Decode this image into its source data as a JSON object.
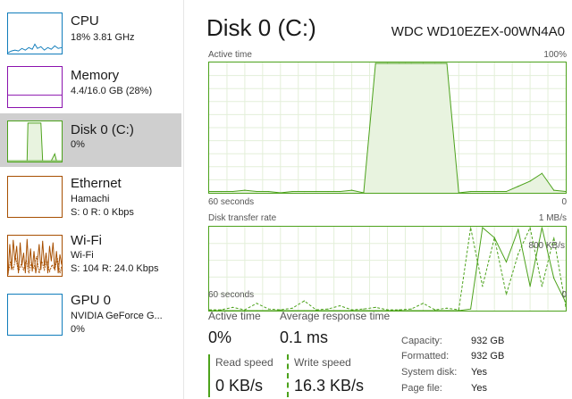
{
  "colors": {
    "cpu": "#117dbb",
    "memory": "#8b12ae",
    "disk": "#4ca21b",
    "ethernet": "#a74f01",
    "wifi": "#a74f01",
    "gpu": "#117dbb",
    "selected_bg": "#cfcfcf"
  },
  "sidebar": {
    "items": [
      {
        "name": "CPU",
        "line1": "18% 3.81 GHz",
        "line2": ""
      },
      {
        "name": "Memory",
        "line1": "4.4/16.0 GB (28%)",
        "line2": ""
      },
      {
        "name": "Disk 0 (C:)",
        "line1": "0%",
        "line2": "",
        "selected": true
      },
      {
        "name": "Ethernet",
        "line1": "Hamachi",
        "line2": "S: 0 R: 0 Kbps"
      },
      {
        "name": "Wi-Fi",
        "line1": "Wi-Fi",
        "line2": "S: 104 R: 24.0 Kbps"
      },
      {
        "name": "GPU 0",
        "line1": "NVIDIA GeForce G...",
        "line2": "0%"
      }
    ]
  },
  "main": {
    "title": "Disk 0 (C:)",
    "model": "WDC WD10EZEX-00WN4A0",
    "active_graph": {
      "label": "Active time",
      "max_label": "100%",
      "time_label": "60 seconds",
      "min_label": "0"
    },
    "transfer_graph": {
      "label": "Disk transfer rate",
      "max_label": "1 MB/s",
      "mid_label": "800 KB/s",
      "time_label": "60 seconds",
      "min_label": "0"
    },
    "stats": {
      "active_time_label": "Active time",
      "active_time_value": "0%",
      "avg_response_label": "Average response time",
      "avg_response_value": "0.1 ms",
      "read_speed_label": "Read speed",
      "read_speed_value": "0 KB/s",
      "write_speed_label": "Write speed",
      "write_speed_value": "16.3 KB/s"
    },
    "properties": [
      {
        "label": "Capacity:",
        "value": "932 GB"
      },
      {
        "label": "Formatted:",
        "value": "932 GB"
      },
      {
        "label": "System disk:",
        "value": "Yes"
      },
      {
        "label": "Page file:",
        "value": "Yes"
      }
    ]
  },
  "chart_data": [
    {
      "type": "area",
      "title": "Active time",
      "xlabel": "60 seconds",
      "ylim": [
        0,
        100
      ],
      "x": [
        60,
        58,
        56,
        54,
        52,
        50,
        48,
        46,
        44,
        42,
        40,
        38,
        36,
        34,
        32,
        30,
        28,
        26,
        24,
        22,
        20,
        18,
        16,
        14,
        12,
        10,
        8,
        6,
        4,
        2,
        0
      ],
      "series": [
        {
          "values": [
            1,
            1,
            1,
            2,
            1,
            1,
            0,
            1,
            1,
            1,
            1,
            1,
            2,
            0,
            100,
            100,
            100,
            100,
            100,
            100,
            100,
            0,
            1,
            1,
            1,
            1,
            5,
            9,
            15,
            2,
            1
          ]
        }
      ]
    },
    {
      "type": "line",
      "title": "Disk transfer rate",
      "xlabel": "60 seconds",
      "ylim": [
        0,
        1024
      ],
      "x": [
        60,
        58,
        56,
        54,
        52,
        50,
        48,
        46,
        44,
        42,
        40,
        38,
        36,
        34,
        32,
        30,
        28,
        26,
        24,
        22,
        20,
        18,
        16,
        14,
        12,
        10,
        8,
        6,
        4,
        2,
        0
      ],
      "series": [
        {
          "name": "Read speed",
          "values": [
            0,
            0,
            0,
            0,
            0,
            0,
            0,
            0,
            0,
            0,
            0,
            0,
            0,
            0,
            0,
            0,
            0,
            0,
            0,
            0,
            0,
            0,
            20,
            1024,
            900,
            600,
            1000,
            300,
            1024,
            400,
            100
          ]
        },
        {
          "name": "Write speed",
          "values": [
            10,
            10,
            40,
            10,
            90,
            20,
            10,
            30,
            120,
            10,
            20,
            60,
            10,
            20,
            40,
            10,
            10,
            20,
            90,
            10,
            30,
            10,
            1024,
            300,
            900,
            200,
            700,
            1024,
            300,
            900,
            50
          ]
        }
      ]
    }
  ]
}
